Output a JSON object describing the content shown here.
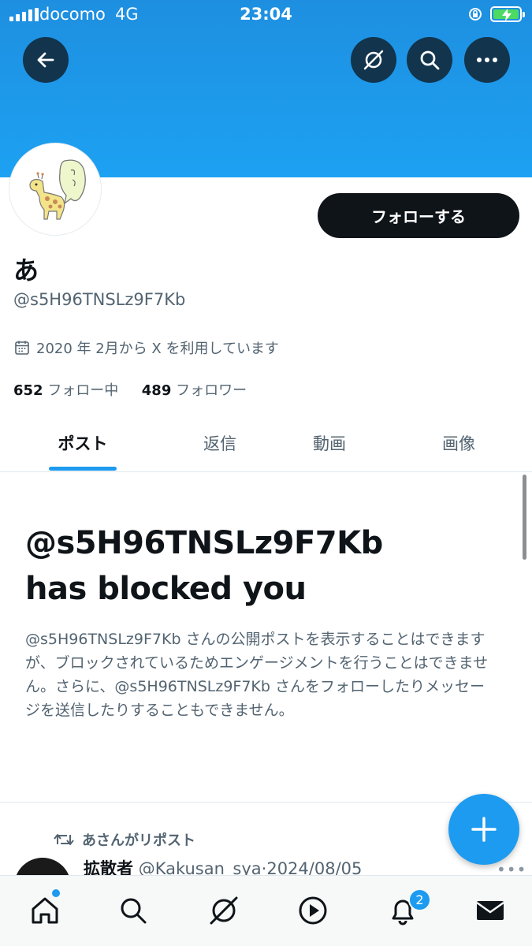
{
  "status_bar": {
    "carrier": "docomo",
    "network": "4G",
    "time": "23:04",
    "battery_color": "#4cd964"
  },
  "header": {
    "back_icon": "arrow-left-icon",
    "grok_icon": "slashed-circle-icon",
    "search_icon": "search-icon",
    "more_icon": "ellipsis-icon",
    "banner_color": "#1da1f2"
  },
  "profile": {
    "follow_label": "フォローする",
    "display_name": "あ",
    "handle": "@s5H96TNSLz9F7Kb",
    "joined": "2020 年 2月から X を利用しています",
    "following_count": "652",
    "following_label": "フォロー中",
    "followers_count": "489",
    "followers_label": "フォロワー"
  },
  "tabs": [
    {
      "label": "ポスト",
      "active": true
    },
    {
      "label": "返信",
      "active": false
    },
    {
      "label": "動画",
      "active": false
    },
    {
      "label": "画像",
      "active": false
    }
  ],
  "blocked": {
    "title_line1": "@s5H96TNSLz9F7Kb",
    "title_line2": "has blocked you",
    "body": "@s5H96TNSLz9F7Kb さんの公開ポストを表示することはできますが、ブロックされているためエンゲージメントを行うことはできません。さらに、@s5H96TNSLz9F7Kb さんをフォローしたりメッセージを送信したりすることもできません。"
  },
  "post": {
    "repost_label": "あさんがリポスト",
    "author_name": "拡散者",
    "author_handle": "@Kakusan_sya",
    "separator": "·",
    "date": "2024/08/05",
    "more": "•••"
  },
  "bottom_nav": {
    "items": [
      "home-icon",
      "search-icon",
      "grok-icon",
      "play-icon",
      "notifications-icon",
      "messages-icon"
    ],
    "notification_badge": "2",
    "accent_color": "#1d9bf0"
  }
}
